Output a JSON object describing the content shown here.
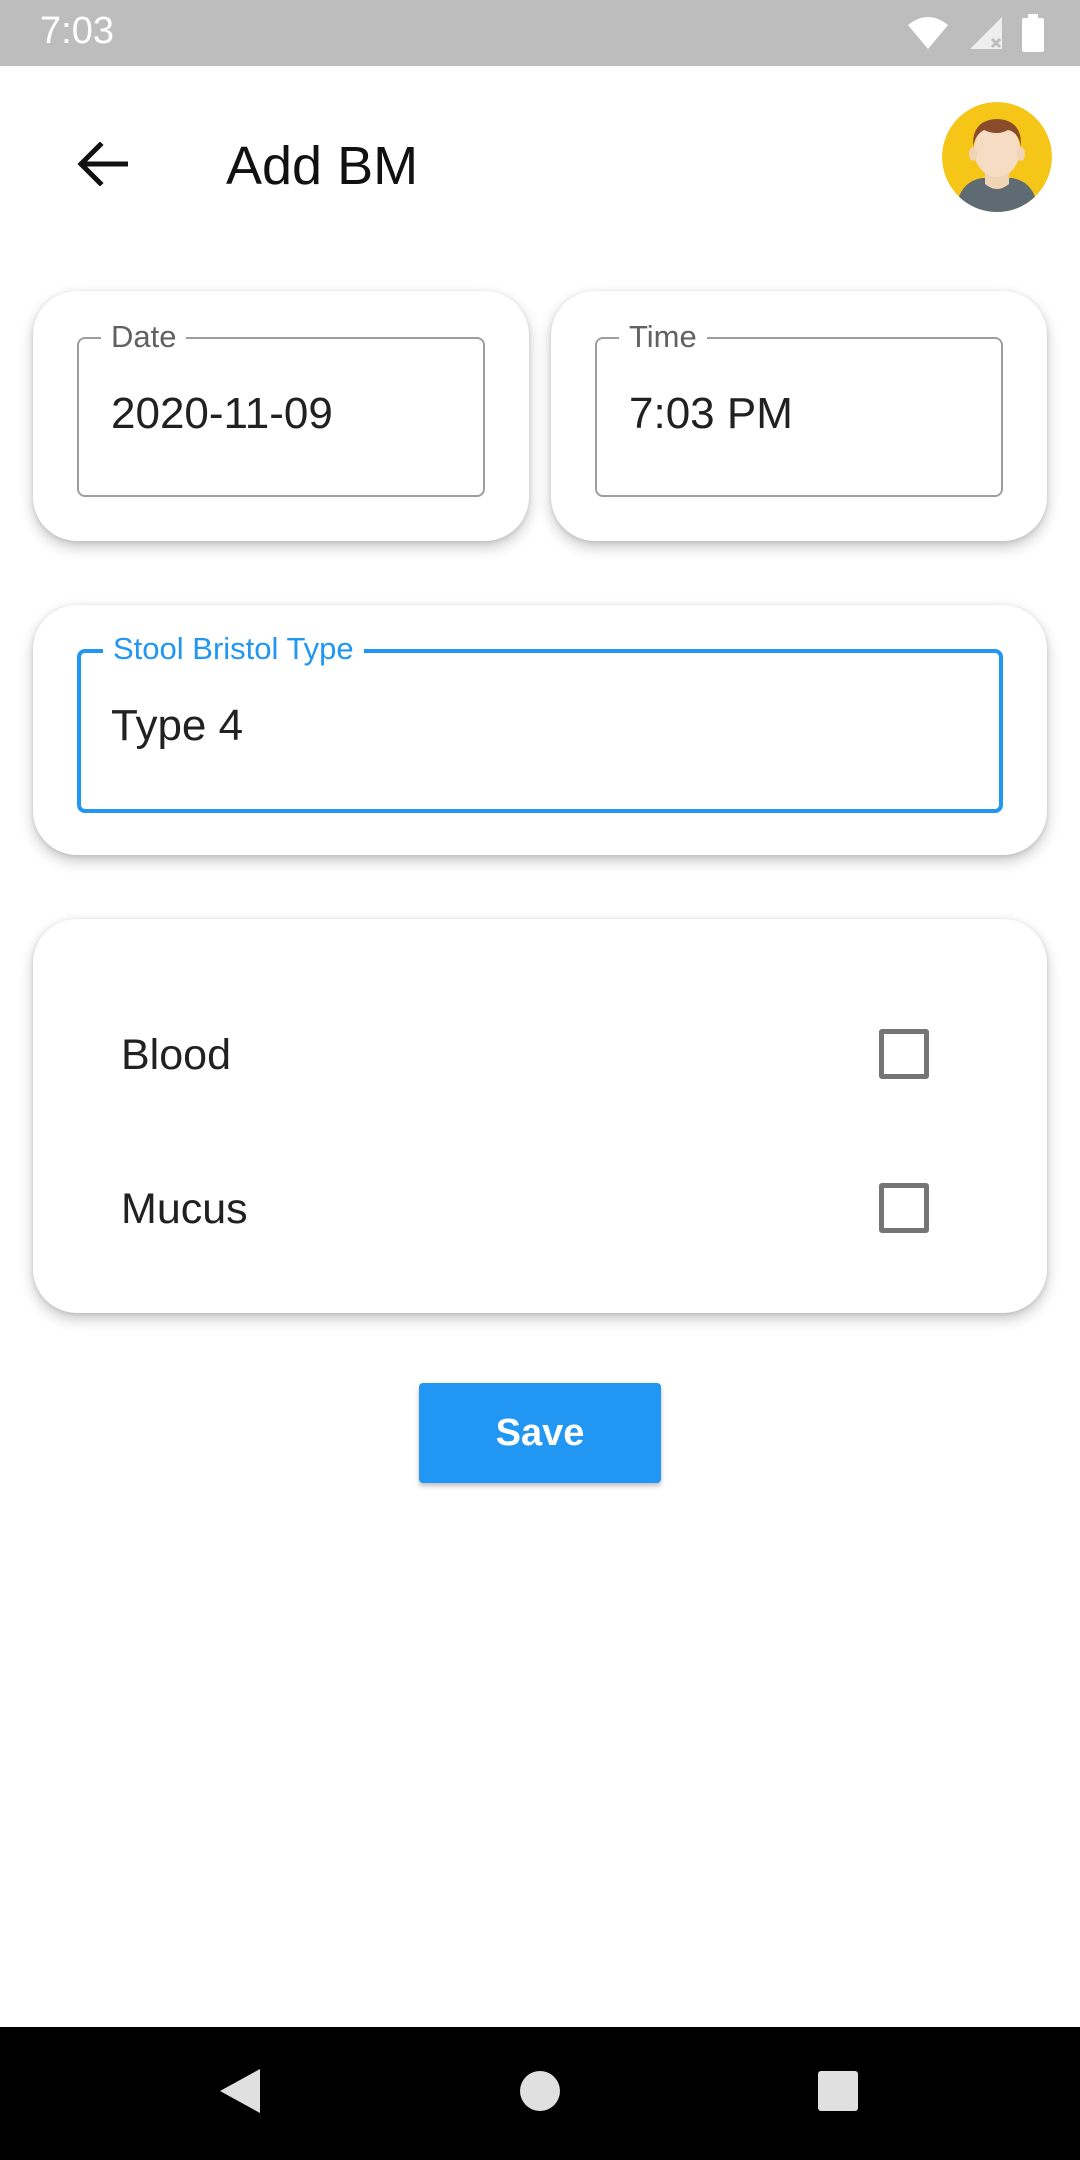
{
  "status_bar": {
    "time": "7:03"
  },
  "header": {
    "title": "Add BM"
  },
  "date_field": {
    "label": "Date",
    "value": "2020-11-09"
  },
  "time_field": {
    "label": "Time",
    "value": "7:03 PM"
  },
  "stool_field": {
    "label": "Stool Bristol Type",
    "value": "Type 4"
  },
  "checks": [
    {
      "label": "Blood",
      "checked": false
    },
    {
      "label": "Mucus",
      "checked": false
    }
  ],
  "save_label": "Save",
  "colors": {
    "accent": "#2196f3",
    "avatar_bg": "#f5c518",
    "status_bar": "#bdbdbd",
    "nav_bar": "#000000"
  },
  "icons": [
    "wifi-icon",
    "signal-icon",
    "battery-icon",
    "back-arrow-icon",
    "avatar",
    "nav-back-icon",
    "nav-home-icon",
    "nav-recents-icon"
  ]
}
